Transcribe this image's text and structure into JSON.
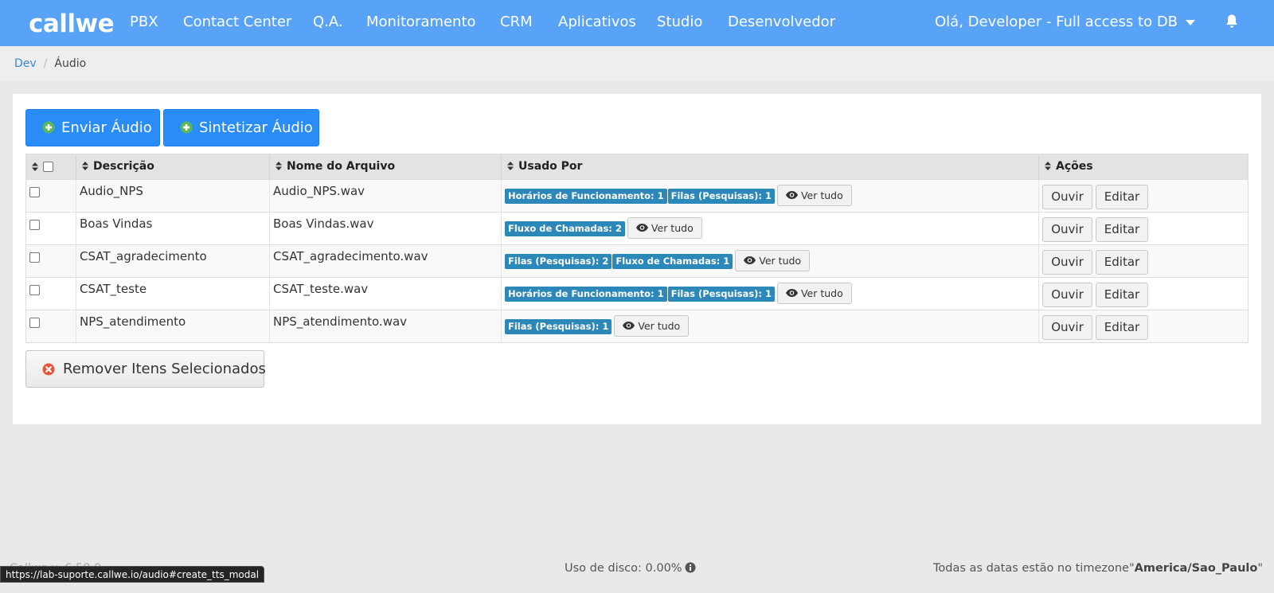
{
  "navbar": {
    "logo": "callwe",
    "items": [
      {
        "label": "PBX"
      },
      {
        "label": "Contact Center"
      },
      {
        "label": "Q.A."
      },
      {
        "label": "Monitoramento"
      },
      {
        "label": "CRM"
      },
      {
        "label": "Aplicativos"
      },
      {
        "label": "Studio"
      },
      {
        "label": "Desenvolvedor"
      }
    ],
    "user_menu": "Olá, Developer - Full access to DB",
    "bell_icon": "bell-icon"
  },
  "breadcrumb": {
    "link": "Dev",
    "separator": "/",
    "current": "Áudio"
  },
  "toolbar": {
    "upload_label": "Enviar Áudio",
    "synthesize_label": "Sintetizar Áudio"
  },
  "table": {
    "headers": {
      "description": "Descrição",
      "filename": "Nome do Arquivo",
      "used_by": "Usado Por",
      "actions": "Ações"
    },
    "view_all_label": "Ver tudo",
    "listen_label": "Ouvir",
    "edit_label": "Editar",
    "rows": [
      {
        "description": "Audio_NPS",
        "filename": "Audio_NPS.wav",
        "badges": [
          "Horários de Funcionamento: 1",
          "Filas (Pesquisas): 1"
        ]
      },
      {
        "description": "Boas Vindas",
        "filename": "Boas Vindas.wav",
        "badges": [
          "Fluxo de Chamadas: 2"
        ]
      },
      {
        "description": "CSAT_agradecimento",
        "filename": "CSAT_agradecimento.wav",
        "badges": [
          "Filas (Pesquisas): 2",
          "Fluxo de Chamadas: 1"
        ]
      },
      {
        "description": "CSAT_teste",
        "filename": "CSAT_teste.wav",
        "badges": [
          "Horários de Funcionamento: 1",
          "Filas (Pesquisas): 1"
        ]
      },
      {
        "description": "NPS_atendimento",
        "filename": "NPS_atendimento.wav",
        "badges": [
          "Filas (Pesquisas): 1"
        ]
      }
    ]
  },
  "remove_label": "Remover Itens Selecionados",
  "footer": {
    "left": "Callwe v. 6.58.0",
    "disk_usage": "Uso de disco: 0.00%",
    "timezone_prefix": "Todas as datas estão no timezone\"",
    "timezone_value": "America/Sao_Paulo",
    "timezone_suffix": "\""
  },
  "status_bar_url": "https://lab-suporte.callwe.io/audio#create_tts_modal",
  "colors": {
    "navbar": "#58a3f8",
    "primary_button": "#2a8cf6",
    "badge": "#2c88b9",
    "remove_icon": "#e8533b",
    "plus_icon": "#5cb85c"
  }
}
